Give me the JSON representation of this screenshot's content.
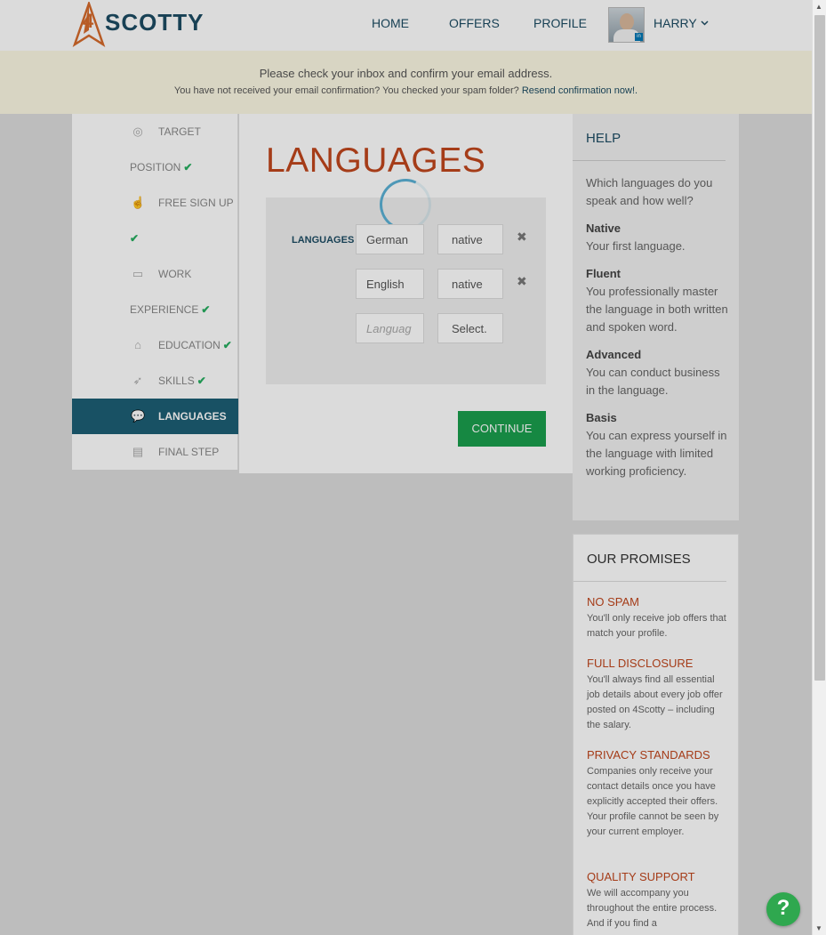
{
  "header": {
    "logo_text": "SCOTTY",
    "logo_digit": "4",
    "nav": [
      "HOME",
      "OFFERS",
      "PROFILE"
    ],
    "user_name": "HARRY"
  },
  "notice": {
    "title": "Please check your inbox and confirm your email address.",
    "text": "You have not received your email confirmation? You checked your spam folder?",
    "link": "Resend confirmation now!."
  },
  "steps": {
    "target_1": "TARGET",
    "target_2": "POSITION",
    "signup": "FREE SIGN UP",
    "work_1": "WORK",
    "work_2": "EXPERIENCE",
    "education": "EDUCATION",
    "skills": "SKILLS",
    "languages": "LANGUAGES",
    "final": "FINAL STEP",
    "check": "✔"
  },
  "main": {
    "title": "LANGUAGES",
    "field_label": "LANGUAGES",
    "rows": [
      {
        "language": "German",
        "level": "native"
      },
      {
        "language": "English",
        "level": "native"
      }
    ],
    "new_language_placeholder": "Languag",
    "new_level_placeholder": "Select.",
    "continue": "CONTINUE"
  },
  "help": {
    "title": "HELP",
    "intro": "Which languages do you speak and how well?",
    "terms": [
      {
        "term": "Native",
        "desc": "Your first language."
      },
      {
        "term": "Fluent",
        "desc": "You professionally master the language in both written and spoken word."
      },
      {
        "term": "Advanced",
        "desc": "You can conduct business in the language."
      },
      {
        "term": "Basis",
        "desc": "You can express yourself in the language with limited working proficiency."
      }
    ]
  },
  "promises": {
    "title": "OUR PROMISES",
    "items": [
      {
        "title": "NO SPAM",
        "text": "You'll only receive job offers that match your profile."
      },
      {
        "title": "FULL DISCLOSURE",
        "text": "You'll always find all essential job details about every job offer posted on 4Scotty – including the salary."
      },
      {
        "title": "PRIVACY STANDARDS",
        "text": "Companies only receive your contact details once you have explicitly accepted their offers. Your profile cannot be seen by your current employer."
      },
      {
        "title": "QUALITY SUPPORT",
        "text": "We will accompany you throughout the entire process. And if you find a"
      }
    ]
  },
  "colors": {
    "brand_blue": "#1d4c63",
    "accent_orange": "#c0461d",
    "success_green": "#1a9f4d",
    "active_step": "#1d5f75"
  },
  "help_bubble": "?"
}
